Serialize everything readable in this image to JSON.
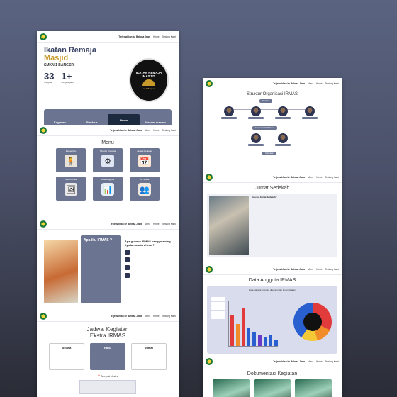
{
  "nav": {
    "brand": "Terjemahkan ke Bahasa Jawa",
    "menu": "Menu",
    "home": "Home",
    "about": "Tentang Kami"
  },
  "hero": {
    "title1": "Ikatan Remaja",
    "title2": "Masjid",
    "school": "SMKN 1 BANGSRI",
    "stat1_num": "33",
    "stat1_lbl": "Anggota",
    "stat2_num": "1+",
    "stat2_lbl": "Penghargaan",
    "emblem_line1": "IKATAN REMAJA",
    "emblem_line2": "MASJID",
    "emblem_sub": "smk Bangsri",
    "tabs": [
      {
        "title": "Kegiatan"
      },
      {
        "title": "Struktur"
      },
      {
        "title": "Home"
      },
      {
        "title": "Macam-macam"
      }
    ]
  },
  "menu": {
    "title": "Menu",
    "tiles": [
      {
        "label": "Pengertian",
        "icon": "person-icon"
      },
      {
        "label": "Struktur Anggota",
        "icon": "network-icon"
      },
      {
        "label": "Jadwal Kegiatan",
        "icon": "calendar-icon"
      },
      {
        "label": "Dokumentasi",
        "icon": "photo-icon"
      },
      {
        "label": "Data Anggota",
        "icon": "chart-icon"
      },
      {
        "label": "Ke Sosial",
        "icon": "people-icon"
      }
    ]
  },
  "about": {
    "card_title": "Apa iku IRMAS ?",
    "list_title": "Apa gunane IRMAS kanggo awing llya lan asaka dhewe?"
  },
  "schedule": {
    "title1": "Jadwal Kegiatan",
    "title2": "Ekstra IRMAS",
    "days": [
      "Selasa",
      "Rabu",
      "Jumat"
    ],
    "place": "Tempat ekstra"
  },
  "right": {
    "org_title": "Struktur Organisasi IRMAS",
    "org_pills": [
      "Pembina",
      "Ketua Dan Wakil Ketua",
      "Sekretaris"
    ],
    "jumat_title": "Jumat Sedekah",
    "jumat_q": "Apa iku Jumat Sedekah?",
    "anggota_title": "Data Anggota IRMAS",
    "chart_title": "Data statistik anggota diagram Dan lan Lingkaran",
    "dok_title": "Dokumentasi Kegiatan"
  }
}
